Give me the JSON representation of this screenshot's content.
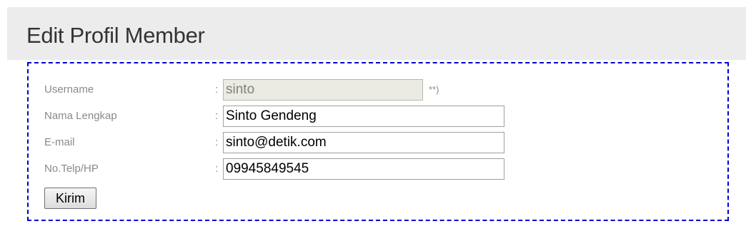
{
  "header": {
    "title": "Edit Profil Member"
  },
  "form": {
    "separator": ":",
    "username": {
      "label": "Username",
      "value": "sinto",
      "note": "**)"
    },
    "fullname": {
      "label": "Nama Lengkap",
      "value": "Sinto Gendeng"
    },
    "email": {
      "label": "E-mail",
      "value": "sinto@detik.com"
    },
    "phone": {
      "label": "No.Telp/HP",
      "value": "09945849545"
    },
    "submit_label": "Kirim"
  },
  "colors": {
    "border_accent": "#0000cc",
    "header_bg": "#ececec",
    "label_text": "#8a8a8a"
  }
}
